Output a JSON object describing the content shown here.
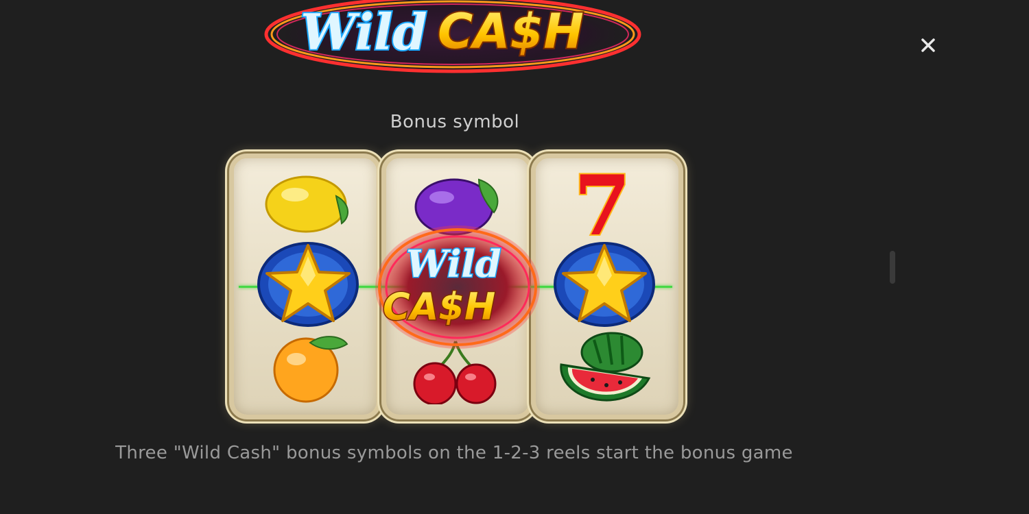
{
  "logo": {
    "word1": "Wild",
    "word2": "CA$H"
  },
  "close": {
    "glyph": "×"
  },
  "section_title": "Bonus symbol",
  "reels": {
    "reel_1": [
      "lemon",
      "star",
      "orange"
    ],
    "reel_2": [
      "plum",
      "wild-cash",
      "cherries"
    ],
    "reel_3": [
      "seven",
      "star",
      "watermelon"
    ],
    "wild_symbol": {
      "word1": "Wild",
      "word2": "CA$H"
    },
    "seven_label": "7"
  },
  "description": "Three \"Wild Cash\" bonus symbols on the 1-2-3 reels start the bonus game",
  "colors": {
    "background": "#1f1f1f",
    "payline": "#46d846",
    "reel_frame": "#d8c8a0",
    "logo_blue": "#38c8ff",
    "logo_gold": "#ffd21a",
    "logo_green": "#2ec64a"
  }
}
